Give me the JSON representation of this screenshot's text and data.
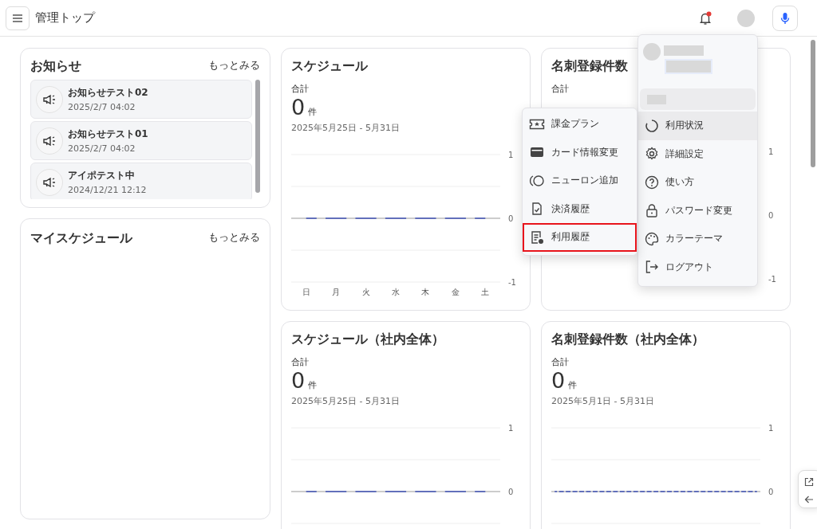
{
  "header": {
    "title": "管理トップ",
    "notification_unread": true
  },
  "notices": {
    "title": "お知らせ",
    "more": "もっとみる",
    "items": [
      {
        "title": "お知らせテスト02",
        "date": "2025/2/7 04:02"
      },
      {
        "title": "お知らせテスト01",
        "date": "2025/2/7 04:02"
      },
      {
        "title": "アイポテスト中",
        "date": "2024/12/21 12:12"
      }
    ]
  },
  "my_schedule": {
    "title": "マイスケジュール",
    "more": "もっとみる"
  },
  "cards": [
    {
      "title": "スケジュール",
      "total_label": "合計",
      "total": "0",
      "unit": "件",
      "range": "2025年5月25日 - 5月31日",
      "chart_data": {
        "type": "line",
        "categories": [
          "日",
          "月",
          "火",
          "水",
          "木",
          "金",
          "土"
        ],
        "series": [
          {
            "color": "#3f51b5",
            "line_style": "dashed",
            "values": [
              0,
              0,
              0,
              0,
              0,
              0,
              0
            ]
          }
        ],
        "ylim": [
          -1,
          1
        ],
        "yticks": [
          1,
          0,
          -1
        ]
      }
    },
    {
      "title": "名刺登録件数",
      "total_label": "合計",
      "axis_labels": [
        "1",
        "0",
        "-1"
      ]
    },
    {
      "title": "スケジュール（社内全体）",
      "total_label": "合計",
      "total": "0",
      "unit": "件",
      "range": "2025年5月25日 - 5月31日",
      "chart_data": {
        "type": "line",
        "categories": [
          null,
          null,
          null,
          null,
          null,
          null,
          null
        ],
        "series": [
          {
            "color": "#3f51b5",
            "line_style": "dashed",
            "values": [
              0,
              0,
              0,
              0,
              0,
              0,
              0
            ]
          }
        ],
        "ylim": [
          0,
          1
        ],
        "yticks": [
          1,
          0
        ]
      }
    },
    {
      "title": "名刺登録件数（社内全体）",
      "total_label": "合計",
      "total": "0",
      "unit": "件",
      "range": "2025年5月1日 - 5月31日",
      "chart_data": {
        "type": "line",
        "categories": [
          null,
          null,
          null,
          null,
          null,
          null,
          null,
          null,
          null,
          null,
          null,
          null,
          null,
          null,
          null,
          null,
          null,
          null,
          null,
          null,
          null,
          null,
          null,
          null,
          null,
          null,
          null,
          null,
          null,
          null,
          null
        ],
        "series": [
          {
            "color": "#3f51b5",
            "line_style": "dashed",
            "values": [
              0,
              0,
              0,
              0,
              0,
              0,
              0,
              0,
              0,
              0,
              0,
              0,
              0,
              0,
              0,
              0,
              0,
              0,
              0,
              0,
              0,
              0,
              0,
              0,
              0,
              0,
              0,
              0,
              0,
              0,
              0
            ]
          }
        ],
        "ylim": [
          0,
          1
        ],
        "yticks": [
          1,
          0
        ]
      }
    }
  ],
  "user_menu": {
    "items": [
      {
        "label": "利用状況",
        "selected": true
      },
      {
        "label": "詳細設定",
        "selected": false
      },
      {
        "label": "使い方",
        "selected": false
      },
      {
        "label": "パスワード変更",
        "selected": false
      },
      {
        "label": "カラーテーマ",
        "selected": false
      },
      {
        "label": "ログアウト",
        "selected": false
      }
    ]
  },
  "submenu": {
    "items": [
      {
        "label": "課金プラン",
        "focused": false
      },
      {
        "label": "カード情報変更",
        "focused": false
      },
      {
        "label": "ニューロン追加",
        "focused": false
      },
      {
        "label": "決済履歴",
        "focused": false
      },
      {
        "label": "利用履歴",
        "focused": true
      }
    ]
  }
}
